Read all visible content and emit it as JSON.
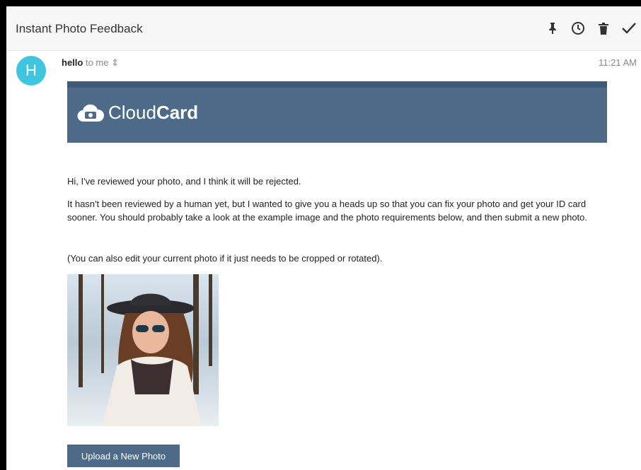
{
  "subject": "Instant Photo Feedback",
  "sender": {
    "initial": "H",
    "name": "hello",
    "to": "to me",
    "time": "11:21 AM"
  },
  "brand": {
    "name_light": "Cloud",
    "name_bold": "Card"
  },
  "message": {
    "p1": "Hi, I've reviewed your photo, and I think it will be rejected.",
    "p2": "It hasn't been reviewed by a human yet, but I wanted to give you a heads up so that you can fix your photo and get your ID card sooner. You should probably take a look at the example image and the photo requirements below, and then submit a new photo.",
    "p3": "(You can also edit your current photo if it just needs to be cropped or rotated)."
  },
  "cta_label": "Upload a New Photo",
  "icons": [
    "pin-icon",
    "clock-icon",
    "trash-icon",
    "check-icon"
  ],
  "colors": {
    "brand_blue": "#4d6b89",
    "avatar": "#3fc5df"
  }
}
